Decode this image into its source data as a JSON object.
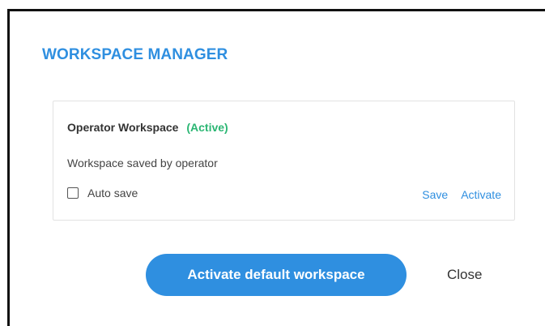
{
  "dialog": {
    "title": "WORKSPACE MANAGER"
  },
  "workspace": {
    "name": "Operator Workspace",
    "status": "(Active)",
    "description": "Workspace saved by operator",
    "auto_save_label": "Auto save",
    "auto_save_checked": false,
    "save_label": "Save",
    "activate_label": "Activate"
  },
  "footer": {
    "activate_default_label": "Activate default workspace",
    "close_label": "Close"
  },
  "colors": {
    "accent": "#2f8fe0",
    "active_status": "#2bb673"
  }
}
